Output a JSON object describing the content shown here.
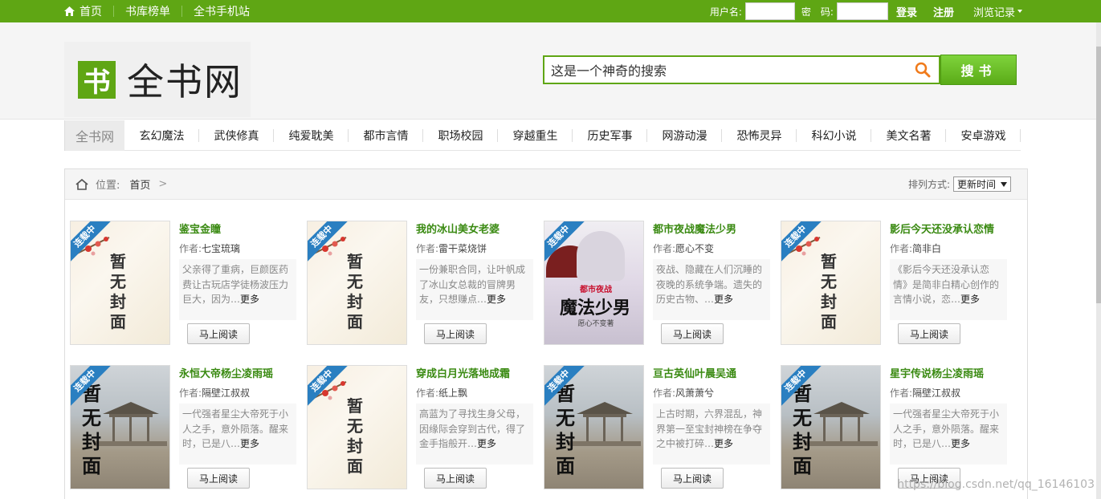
{
  "topbar": {
    "home_label": "首页",
    "nav_ranking": "书库榜单",
    "nav_mobile": "全书手机站",
    "username_label": "用户名:",
    "password_label": "密　码:",
    "login_label": "登录",
    "register_label": "注册",
    "history_label": "浏览记录"
  },
  "header": {
    "logo_mark": "书",
    "logo_text": "全书网",
    "search_value": "这是一个神奇的搜索",
    "search_button": "搜书"
  },
  "catnav": {
    "brand": "全书网",
    "items": [
      "玄幻魔法",
      "武侠修真",
      "纯爱耽美",
      "都市言情",
      "职场校园",
      "穿越重生",
      "历史军事",
      "网游动漫",
      "恐怖灵异",
      "科幻小说",
      "美文名著",
      "安卓游戏"
    ]
  },
  "breadcrumb": {
    "position_label": "位置:",
    "home": "首页",
    "separator": ">"
  },
  "sort": {
    "label": "排列方式:",
    "selected": "更新时间"
  },
  "common": {
    "author_label": "作者:",
    "more_label": "更多",
    "read_button": "马上阅读",
    "nocover_text": "暂无封面",
    "ribbon_text": "连载中"
  },
  "books": [
    {
      "title": "鉴宝金瞳",
      "author": "七宝琉璃",
      "desc": "父亲得了重病，巨颜医药费让古玩店学徒杨波压力巨大，因为…",
      "cover": "type-a"
    },
    {
      "title": "我的冰山美女老婆",
      "author": "雷干菜烧饼",
      "desc": "一份兼职合同，让叶帆成了冰山女总裁的冒牌男友，只想赚点…",
      "cover": "type-a"
    },
    {
      "title": "都市夜战魔法少男",
      "author": "愿心不变",
      "desc": "夜战、隐藏在人们沉睡的夜晚的系统争端。遗失的历史古物、…",
      "cover": "type-c"
    },
    {
      "title": "影后今天还没承认恋情",
      "author": "简非白",
      "desc": "《影后今天还没承认恋情》是简非白精心创作的言情小说，恋…",
      "cover": "type-a"
    },
    {
      "title": "永恒大帝杨尘凌雨瑶",
      "author": "隔壁江叔叔",
      "desc": "一代强者星尘大帝死于小人之手，意外陨落。醒来时，已是八…",
      "cover": "type-b"
    },
    {
      "title": "穿成白月光落地成霜",
      "author": "纸上飘",
      "desc": "高蓝为了寻找生身父母，因缘际会穿到古代，得了金手指般开…",
      "cover": "type-a"
    },
    {
      "title": "亘古英仙叶晨吴通",
      "author": "风萧萧兮",
      "desc": "上古时期，六界混乱，神界第一至宝封神榜在争夺之中被打碎…",
      "cover": "type-b"
    },
    {
      "title": "星宇传说杨尘凌雨瑶",
      "author": "隔壁江叔叔",
      "desc": "一代强者星尘大帝死于小人之手，意外陨落。醒来时，已是八…",
      "cover": "type-b"
    }
  ],
  "mahou_cover": {
    "subtitle": "都市夜战",
    "title": "魔法少男",
    "author": "愿心不变著"
  },
  "watermark": "https://blog.csdn.net/qq_16146103",
  "colors": {
    "brand_green": "#5fa614",
    "title_green": "#3a8a12"
  }
}
